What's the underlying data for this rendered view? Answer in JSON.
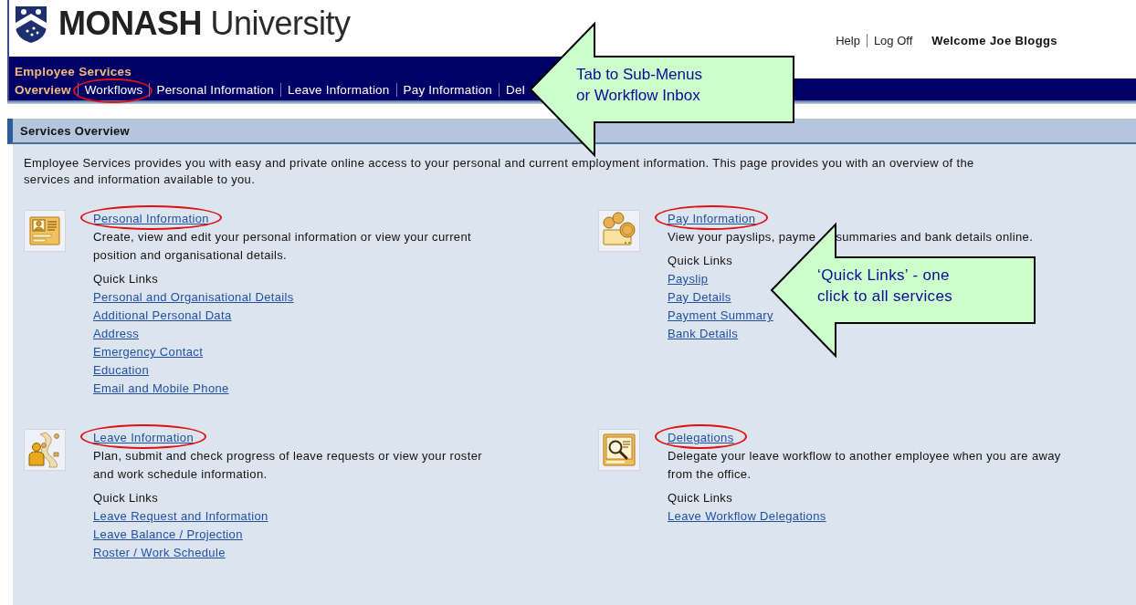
{
  "header": {
    "logo": "**MONASH** University",
    "links": [
      "Help",
      "Log Off"
    ],
    "welcome": "Welcome Joe Bloggs"
  },
  "nav": {
    "title": "Employee Services",
    "tabs": [
      {
        "label": "Overview",
        "selected": true,
        "circled": false
      },
      {
        "label": "Workflows",
        "selected": false,
        "circled": true
      },
      {
        "label": "Personal Information",
        "selected": false,
        "circled": false
      },
      {
        "label": "Leave Information",
        "selected": false,
        "circled": false
      },
      {
        "label": "Pay Information",
        "selected": false,
        "circled": false
      },
      {
        "label": "Del",
        "selected": false,
        "circled": false
      }
    ],
    "callout": {
      "lines": [
        "Tab to Sub-Menus",
        "or Workflow Inbox"
      ]
    }
  },
  "section": {
    "title": "Services Overview",
    "intro": [
      "Employee Services provides you with easy and private online access to your personal and current employment information.  This page provides you with an overview of the",
      "services and information available to you."
    ]
  },
  "services": [
    {
      "kind": "personal",
      "title": "Personal Information",
      "circled": true,
      "description": [
        "Create, view and edit your personal information or view your current",
        "position and organisational details."
      ],
      "quick_links_label": "Quick Links",
      "quick_links": [
        "Personal and Organisational Details",
        "Additional Personal Data",
        "Address",
        "Emergency Contact",
        "Education",
        "Email and Mobile Phone"
      ]
    },
    {
      "kind": "pay",
      "title": "Pay Information",
      "circled": true,
      "description": [
        "View your payslips, payme"
      ],
      "description_after": "summaries and bank details online.",
      "callout": {
        "lines": [
          "‘Quick Links’ - one",
          "click to all services"
        ]
      },
      "quick_links_label": "Quick Links",
      "quick_links": [
        "Payslip",
        "Pay Details",
        "Payment Summary",
        "Bank Details"
      ]
    },
    {
      "kind": "leave",
      "title": "Leave Information",
      "circled": true,
      "description": [
        "Plan, submit and check progress of leave requests or view your roster",
        "and work schedule information."
      ],
      "quick_links_label": "Quick Links",
      "quick_links": [
        "Leave Request and Information",
        "Leave Balance / Projection",
        "Roster / Work Schedule"
      ]
    },
    {
      "kind": "delegation",
      "title": "Delegations",
      "circled": true,
      "description": [
        "Delegate your leave workflow to another employee when you are away",
        "from the office."
      ],
      "quick_links_label": "Quick Links",
      "quick_links": [
        "Leave Workflow Delegations"
      ]
    }
  ]
}
